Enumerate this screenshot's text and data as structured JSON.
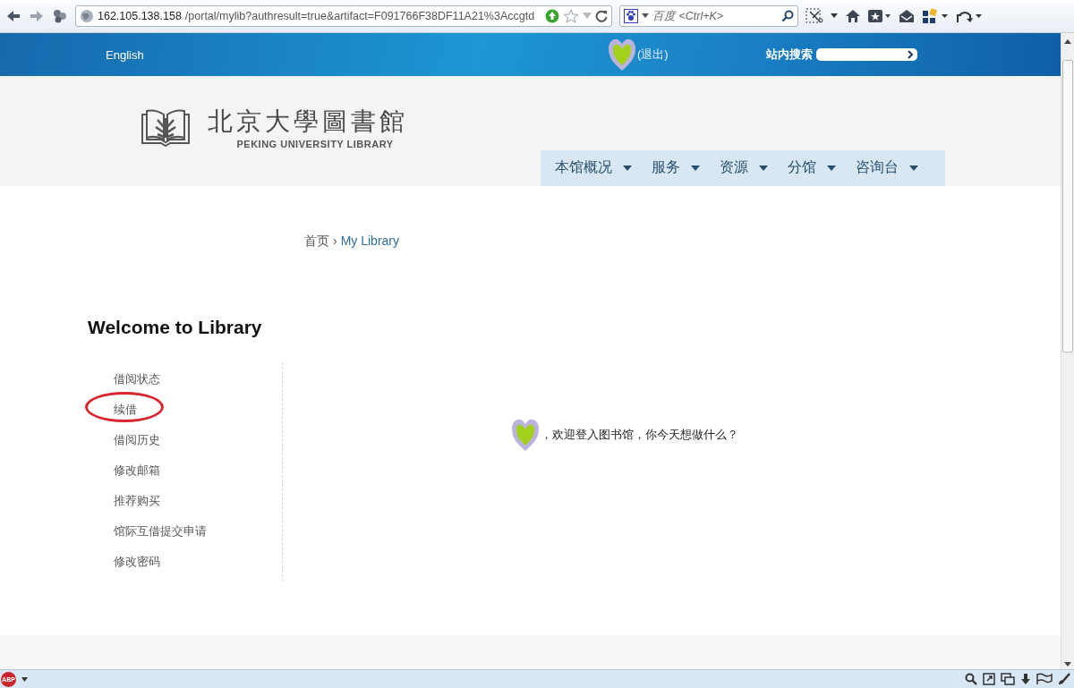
{
  "browser": {
    "url_host": "162.105.138.158",
    "url_path": "/portal/mylib?authresult=true&artifact=F091766F38DF11A21%3Accgtd",
    "search_placeholder": "百度 <Ctrl+K>"
  },
  "header": {
    "language": "English",
    "logout": "(退出)",
    "search_label": "站内搜索"
  },
  "logo": {
    "name_zh": "北京大學圖書館",
    "name_en": "PEKING UNIVERSITY LIBRARY"
  },
  "nav": [
    {
      "label": "本馆概况"
    },
    {
      "label": "服务"
    },
    {
      "label": "资源"
    },
    {
      "label": "分馆"
    },
    {
      "label": "咨询台"
    }
  ],
  "breadcrumb": {
    "home": "首页",
    "separator": "›",
    "current": "My Library"
  },
  "heading": "Welcome to Library",
  "sidebar": {
    "items": [
      {
        "label": "借阅状态",
        "highlighted": false
      },
      {
        "label": "续借",
        "highlighted": true
      },
      {
        "label": "借阅历史",
        "highlighted": false
      },
      {
        "label": "修改邮箱",
        "highlighted": false
      },
      {
        "label": "推荐购买",
        "highlighted": false
      },
      {
        "label": "馆际互借提交申请",
        "highlighted": false
      },
      {
        "label": "修改密码",
        "highlighted": false
      }
    ]
  },
  "message": "，欢迎登入图书馆，你今天想做什么？",
  "status_bar": {
    "addon": "ABP"
  }
}
